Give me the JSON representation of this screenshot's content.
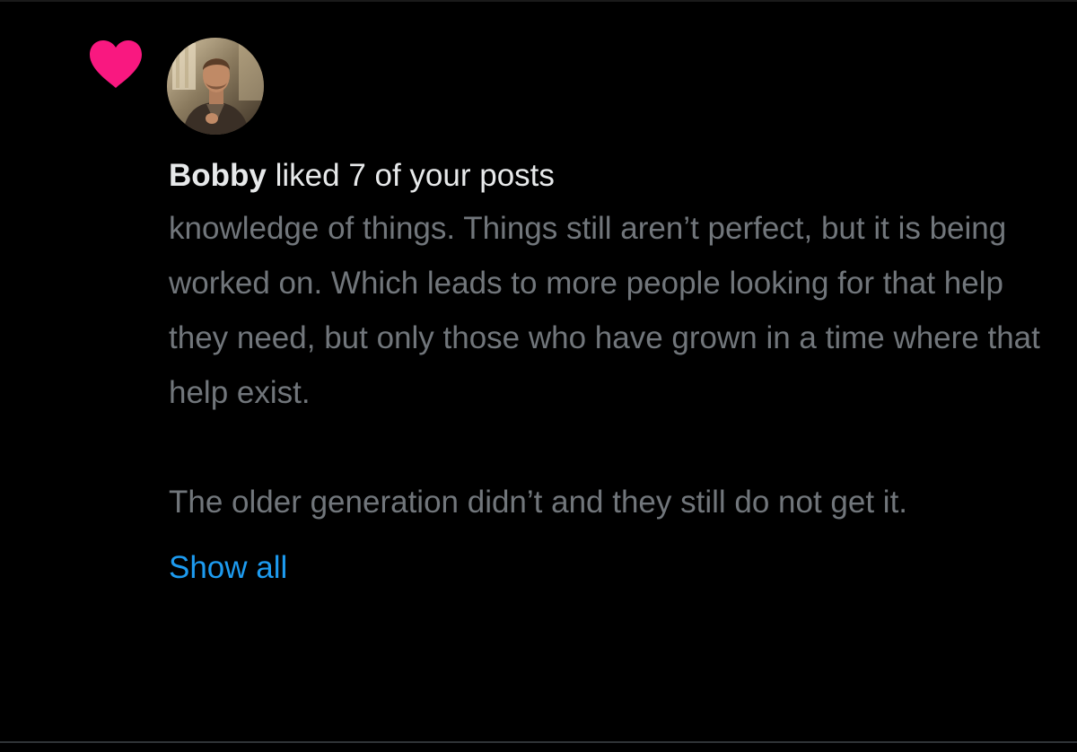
{
  "notification": {
    "type_icon": "heart-icon",
    "icon_color": "#f91880",
    "avatar": "profile-photo",
    "actor_name": "Bobby",
    "action_text": " liked 7 of your posts",
    "post_paragraphs": [
      "knowledge of things. Things still aren’t perfect, but it is being worked on. Which leads to more people looking for that help they need, but only those who have grown in a time where that help exist.",
      "The older generation didn’t and they still do not get it."
    ],
    "show_all_label": "Show all"
  },
  "colors": {
    "background": "#000000",
    "primary_text": "#e7e9ea",
    "secondary_text": "#71767b",
    "link": "#1d9bf0",
    "like": "#f91880"
  }
}
